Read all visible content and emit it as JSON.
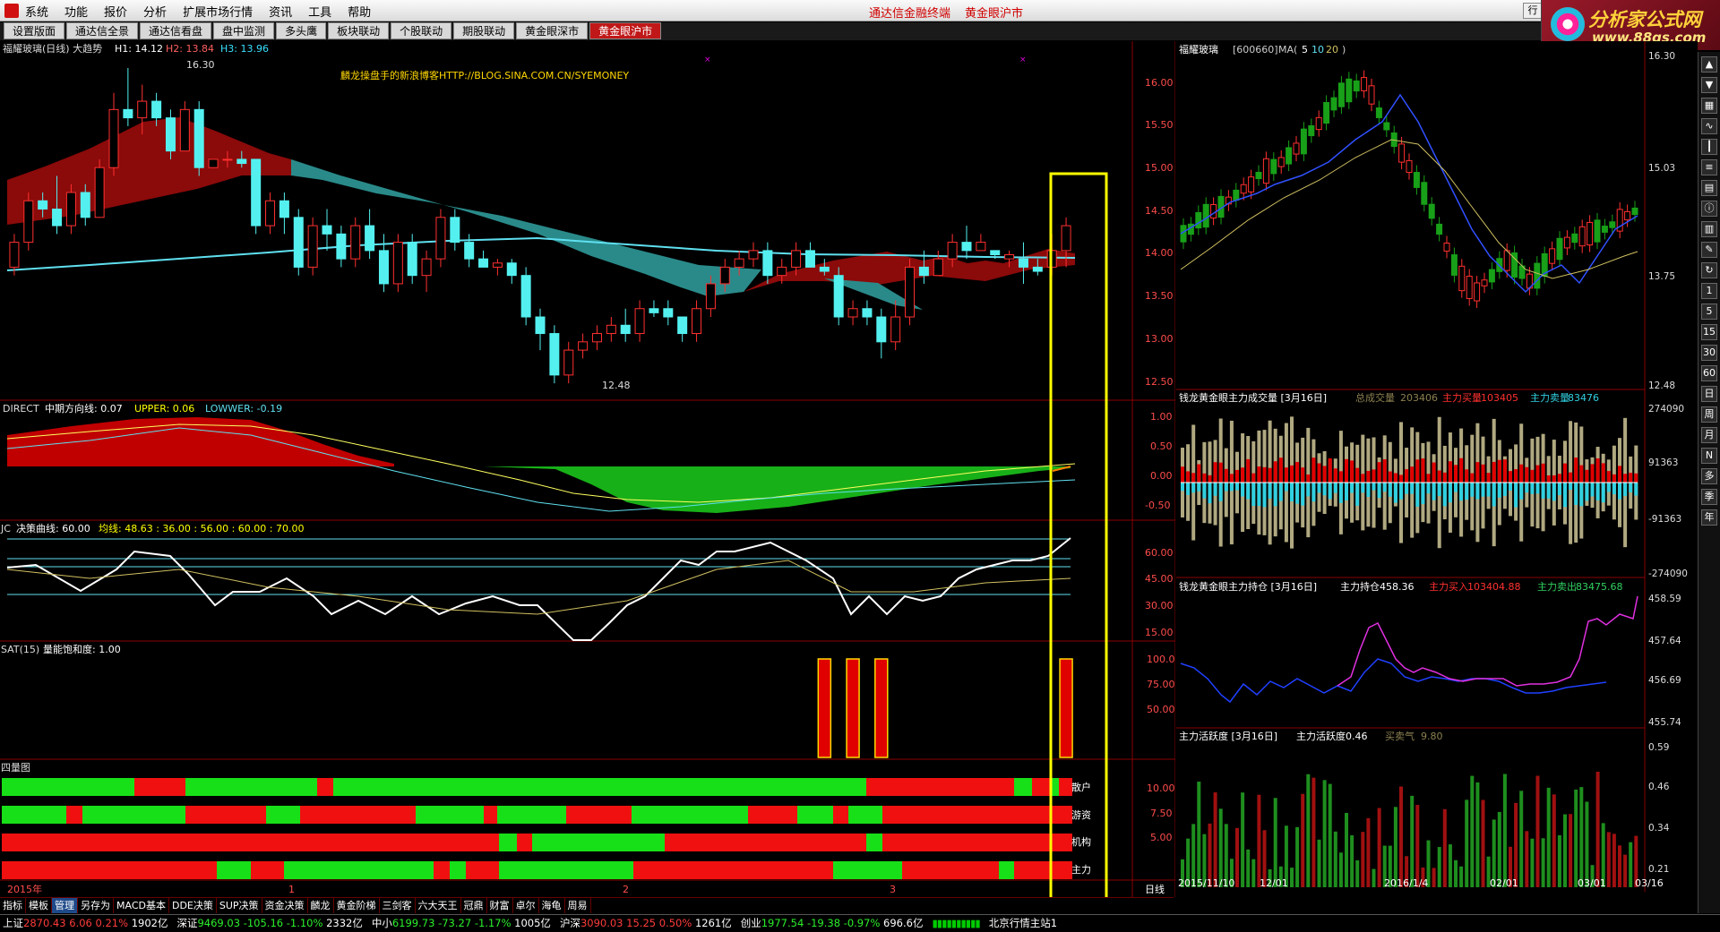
{
  "titlebar": {
    "menu": [
      "系统",
      "功能",
      "报价",
      "分析",
      "扩展市场行情",
      "资讯",
      "工具",
      "帮助"
    ],
    "title1": "通达信金融终端",
    "title2": "黄金眼沪市",
    "win_button": "行"
  },
  "brand": {
    "name": "分析家公式网",
    "url": "www.88gs.com"
  },
  "tabs": [
    "设置版面",
    "通达信全景",
    "通达信看盘",
    "盘中监测",
    "多头鹰",
    "板块联动",
    "个股联动",
    "期股联动",
    "黄金眼深市",
    "黄金眼沪市"
  ],
  "active_tab": 9,
  "main": {
    "header": {
      "name": "福耀玻璃(日线) 大趋势",
      "h1": "H1: 14.12",
      "h2": "H2: 13.84",
      "h3": "H3: 13.96"
    },
    "blog": "麟龙操盘手的新浪博客HTTP://BLOG.SINA.COM.CN/SYEMONEY",
    "price_axis": [
      "16.00",
      "15.50",
      "15.00",
      "14.50",
      "14.00",
      "13.50",
      "13.00",
      "12.50"
    ],
    "high_label": "16.30",
    "low_label": "12.48",
    "direct": {
      "name": "DIRECT",
      "line": "中期方向线: 0.07",
      "upper": "UPPER: 0.06",
      "lower": "LOWWER: -0.19",
      "axis": [
        "1.00",
        "0.50",
        "0.00",
        "-0.50"
      ]
    },
    "jc": {
      "name": "JC",
      "line": "决策曲线: 60.00",
      "avg": "均线: 48.63 : 36.00 : 56.00 : 60.00 : 70.00",
      "axis": [
        "60.00",
        "45.00",
        "30.00",
        "15.00"
      ]
    },
    "sat": {
      "name": "SAT(15)",
      "line": "量能饱和度: 1.00",
      "axis": [
        "100.0",
        "75.00",
        "50.00"
      ]
    },
    "siliang": {
      "name": "四量图",
      "axis": [
        "10.00",
        "7.50",
        "5.00"
      ],
      "labels": [
        "散户",
        "游资",
        "机构",
        "主力"
      ]
    },
    "xaxis": {
      "year": "2015年",
      "m1": "1",
      "m2": "2",
      "m3": "3",
      "period": "日线"
    }
  },
  "chart_data": [
    {
      "type": "candlestick",
      "title": "福耀玻璃(日线) 大趋势",
      "ylim": [
        12.4,
        16.35
      ],
      "high": 16.3,
      "low": 12.48,
      "candles": [
        [
          13.9,
          14.3,
          13.8,
          14.2
        ],
        [
          14.2,
          14.8,
          14.1,
          14.7
        ],
        [
          14.7,
          14.8,
          14.5,
          14.6
        ],
        [
          14.6,
          15.0,
          14.3,
          14.4
        ],
        [
          14.4,
          14.9,
          14.3,
          14.8
        ],
        [
          14.8,
          14.9,
          14.4,
          14.5
        ],
        [
          14.5,
          15.2,
          14.5,
          15.1
        ],
        [
          15.1,
          16.0,
          15.0,
          15.8
        ],
        [
          15.8,
          16.3,
          15.6,
          15.7
        ],
        [
          15.7,
          16.1,
          15.5,
          15.9
        ],
        [
          15.9,
          16.0,
          15.6,
          15.7
        ],
        [
          15.7,
          15.8,
          15.2,
          15.3
        ],
        [
          15.3,
          15.9,
          15.3,
          15.8
        ],
        [
          15.8,
          15.9,
          15.0,
          15.1
        ],
        [
          15.1,
          15.2,
          15.1,
          15.2
        ],
        [
          15.2,
          15.3,
          15.1,
          15.2
        ],
        [
          15.2,
          15.3,
          15.1,
          15.15
        ],
        [
          15.2,
          15.2,
          14.3,
          14.4
        ],
        [
          14.4,
          14.8,
          14.3,
          14.7
        ],
        [
          14.7,
          14.8,
          14.3,
          14.5
        ],
        [
          14.5,
          14.6,
          13.8,
          13.9
        ],
        [
          13.9,
          14.5,
          13.8,
          14.4
        ],
        [
          14.4,
          14.6,
          14.1,
          14.3
        ],
        [
          14.3,
          14.4,
          13.9,
          14.0
        ],
        [
          14.0,
          14.5,
          13.9,
          14.4
        ],
        [
          14.4,
          14.6,
          14.0,
          14.1
        ],
        [
          14.1,
          14.3,
          13.6,
          13.7
        ],
        [
          13.7,
          14.3,
          13.6,
          14.2
        ],
        [
          14.2,
          14.3,
          13.7,
          13.8
        ],
        [
          13.8,
          14.1,
          13.6,
          14.0
        ],
        [
          14.0,
          14.6,
          13.9,
          14.5
        ],
        [
          14.5,
          14.6,
          14.1,
          14.2
        ],
        [
          14.2,
          14.3,
          13.9,
          14.0
        ],
        [
          14.0,
          14.1,
          13.9,
          13.9
        ],
        [
          13.9,
          14.0,
          13.8,
          13.95
        ],
        [
          13.95,
          14.0,
          13.7,
          13.8
        ],
        [
          13.8,
          13.9,
          13.2,
          13.3
        ],
        [
          13.3,
          13.4,
          12.9,
          13.1
        ],
        [
          13.1,
          13.2,
          12.5,
          12.6
        ],
        [
          12.6,
          13.0,
          12.5,
          12.9
        ],
        [
          12.9,
          13.1,
          12.8,
          13.0
        ],
        [
          13.0,
          13.2,
          12.9,
          13.1
        ],
        [
          13.1,
          13.3,
          13.0,
          13.2
        ],
        [
          13.2,
          13.4,
          13.0,
          13.1
        ],
        [
          13.1,
          13.5,
          13.0,
          13.4
        ],
        [
          13.4,
          13.5,
          13.3,
          13.35
        ],
        [
          13.4,
          13.5,
          13.2,
          13.3
        ],
        [
          13.3,
          13.3,
          13.0,
          13.1
        ],
        [
          13.1,
          13.5,
          13.0,
          13.4
        ],
        [
          13.4,
          13.8,
          13.3,
          13.7
        ],
        [
          13.7,
          14.0,
          13.6,
          13.9
        ],
        [
          13.9,
          14.1,
          13.8,
          14.0
        ],
        [
          14.0,
          14.2,
          13.9,
          14.1
        ],
        [
          14.1,
          14.2,
          13.7,
          13.8
        ],
        [
          13.8,
          14.0,
          13.7,
          13.9
        ],
        [
          13.9,
          14.2,
          13.8,
          14.1
        ],
        [
          14.1,
          14.2,
          13.9,
          13.9
        ],
        [
          13.9,
          14.0,
          13.8,
          13.85
        ],
        [
          13.8,
          13.9,
          13.2,
          13.3
        ],
        [
          13.3,
          13.5,
          13.2,
          13.4
        ],
        [
          13.4,
          13.5,
          13.2,
          13.3
        ],
        [
          13.3,
          13.4,
          12.8,
          13.0
        ],
        [
          13.0,
          13.5,
          12.9,
          13.3
        ],
        [
          13.3,
          14.0,
          13.2,
          13.9
        ],
        [
          13.9,
          14.1,
          13.7,
          13.8
        ],
        [
          13.8,
          14.1,
          13.8,
          14.0
        ],
        [
          14.0,
          14.3,
          13.9,
          14.2
        ],
        [
          14.2,
          14.4,
          14.0,
          14.1
        ],
        [
          14.1,
          14.3,
          14.1,
          14.2
        ],
        [
          14.1,
          14.1,
          14.0,
          14.05
        ],
        [
          14.0,
          14.1,
          13.9,
          14.05
        ],
        [
          14.0,
          14.2,
          13.7,
          13.9
        ],
        [
          13.9,
          14.0,
          13.8,
          13.85
        ],
        [
          13.9,
          14.3,
          13.8,
          14.1
        ],
        [
          14.1,
          14.5,
          13.9,
          14.4
        ]
      ]
    },
    {
      "type": "bar",
      "title": "SAT(15) 量能饱和度",
      "values_at_candle": {
        "57": 100,
        "59": 100,
        "61": 100,
        "74": 100
      }
    },
    {
      "type": "line",
      "title": "福耀玻璃 [600660] MA(5 10 20)",
      "ma": [
        "5",
        "10",
        "20"
      ],
      "yaxis": [
        "16.30",
        "15.03",
        "13.75",
        "12.48"
      ]
    },
    {
      "type": "bar",
      "title": "钱龙黄金眼主力成交量 [3月16日]",
      "series": [
        {
          "name": "总成交量",
          "value": "203406"
        },
        {
          "name": "主力买量",
          "value": "103405"
        },
        {
          "name": "主力卖量",
          "value": "83476"
        }
      ],
      "yaxis": [
        "274090",
        "91363",
        "-91363",
        "-274090"
      ]
    },
    {
      "type": "line",
      "title": "钱龙黄金眼主力持仓 [3月16日]",
      "series": [
        {
          "name": "主力持仓",
          "value": "458.36"
        },
        {
          "name": "主力买入",
          "value": "103404.88"
        },
        {
          "name": "主力卖出",
          "value": "83475.68"
        }
      ],
      "yaxis": [
        "458.59",
        "457.64",
        "456.69",
        "455.74"
      ]
    },
    {
      "type": "bar",
      "title": "主力活跃度 [3月16日]",
      "series": [
        {
          "name": "主力活跃度",
          "value": "0.46"
        },
        {
          "name": "买卖气",
          "value": "9.80"
        }
      ],
      "yaxis": [
        "0.59",
        "0.46",
        "0.34",
        "0.21"
      ]
    }
  ],
  "right": {
    "k_header": {
      "name": "福耀玻璃",
      "code": "[600660]",
      "ma": "MA(",
      "ma5": "5",
      "ma10": "10",
      "ma20": "20",
      "close": ")"
    },
    "k_axis": [
      "16.30",
      "15.03",
      "13.75",
      "12.48"
    ],
    "vol_header": {
      "name": "钱龙黄金眼主力成交量 [3月16日]",
      "total": "总成交量",
      "total_v": "203406",
      "buy": "主力买量",
      "buy_v": "103405",
      "sell": "主力卖量",
      "sell_v": "83476"
    },
    "vol_axis": [
      "274090",
      "91363",
      "-91363",
      "-274090"
    ],
    "pos_header": {
      "name": "钱龙黄金眼主力持仓 [3月16日]",
      "pos": "主力持仓",
      "pos_v": "458.36",
      "in": "主力买入",
      "in_v": "103404.88",
      "out": "主力卖出",
      "out_v": "83475.68"
    },
    "pos_axis": [
      "458.59",
      "457.64",
      "456.69",
      "455.74"
    ],
    "act_header": {
      "name": "主力活跃度 [3月16日]",
      "act": "主力活跃度",
      "act_v": "0.46",
      "mq": "买卖气",
      "mq_v": "9.80"
    },
    "act_axis": [
      "0.59",
      "0.46",
      "0.34",
      "0.21"
    ],
    "dates": [
      "2015/11/10",
      "12/01",
      "2016/1/4",
      "02/01",
      "03/01",
      "03/16"
    ]
  },
  "toolbar_letters": [
    "1",
    "5",
    "15",
    "30",
    "60",
    "日",
    "周",
    "月",
    "N",
    "多",
    "季",
    "年"
  ],
  "bottom_tabs": [
    "指标",
    "模板",
    "管理",
    "另存为",
    "MACD基本",
    "DDE决策",
    "SUP决策",
    "资金决策",
    "麟龙",
    "黄金阶梯",
    "三剑客",
    "六大天王",
    "冠鼎",
    "财富",
    "卓尔",
    "海龟",
    "周易"
  ],
  "status": {
    "sh": {
      "name": "上证",
      "v": "2870.43",
      "chg": "6.06",
      "pct": "0.21%",
      "amt": "1902亿"
    },
    "sz": {
      "name": "深证",
      "v": "9469.03",
      "chg": "-105.16",
      "pct": "-1.10%",
      "amt": "2332亿"
    },
    "zx": {
      "name": "中小",
      "v": "6199.73",
      "chg": "-73.27",
      "pct": "-1.17%",
      "amt": "1005亿"
    },
    "hs": {
      "name": "沪深",
      "v": "3090.03",
      "chg": "15.25",
      "pct": "0.50%",
      "amt": "1261亿"
    },
    "cy": {
      "name": "创业",
      "v": "1977.54",
      "chg": "-19.38",
      "pct": "-0.97%",
      "amt": "696.6亿"
    },
    "server": "北京行情主站1"
  }
}
